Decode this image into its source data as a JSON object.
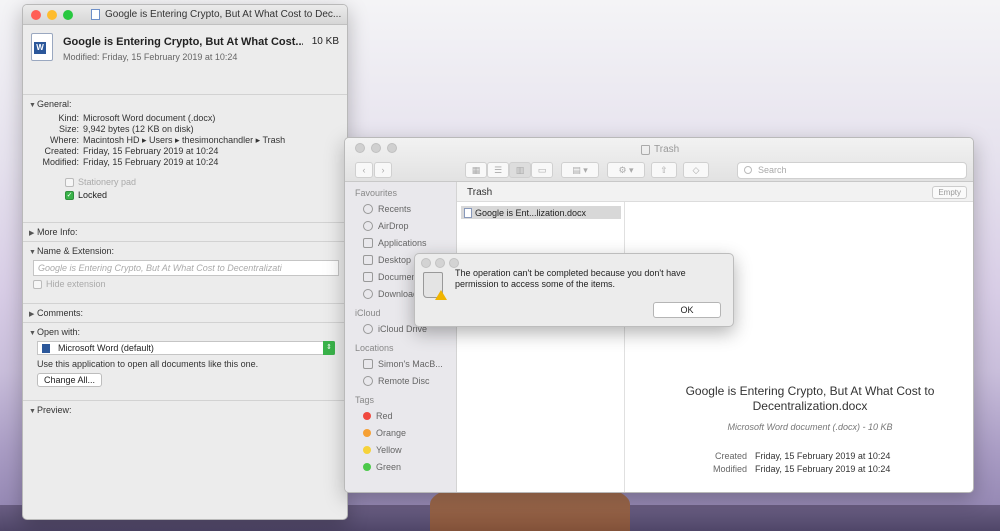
{
  "info_window": {
    "title": "Google is Entering Crypto, But At What Cost to Dec...",
    "file_name": "Google is Entering Crypto, But At What Cost...",
    "file_size": "10 KB",
    "modified_line": "Modified: Friday, 15 February 2019 at 10:24",
    "general": {
      "heading": "General:",
      "rows": [
        {
          "k": "Kind:",
          "v": "Microsoft Word document (.docx)"
        },
        {
          "k": "Size:",
          "v": "9,942 bytes (12 KB on disk)"
        },
        {
          "k": "Where:",
          "v": "Macintosh HD ▸ Users ▸ thesimonchandler ▸ Trash"
        },
        {
          "k": "Created:",
          "v": "Friday, 15 February 2019 at 10:24"
        },
        {
          "k": "Modified:",
          "v": "Friday, 15 February 2019 at 10:24"
        }
      ],
      "stationery_label": "Stationery pad",
      "locked_label": "Locked"
    },
    "more_info_heading": "More Info:",
    "name_ext": {
      "heading": "Name & Extension:",
      "field_value": "Google is Entering Crypto, But At What Cost to Decentralizati",
      "hide_ext_label": "Hide extension"
    },
    "comments_heading": "Comments:",
    "open_with": {
      "heading": "Open with:",
      "app": "Microsoft Word (default)",
      "hint": "Use this application to open all documents like this one.",
      "change_all": "Change All..."
    },
    "preview_heading": "Preview:"
  },
  "finder": {
    "title": "Trash",
    "search_placeholder": "Search",
    "sidebar": {
      "favourites_heading": "Favourites",
      "favourites": [
        "Recents",
        "AirDrop",
        "Applications",
        "Desktop",
        "Documents",
        "Downloads"
      ],
      "icloud_heading": "iCloud",
      "icloud": [
        "iCloud Drive"
      ],
      "locations_heading": "Locations",
      "locations": [
        "Simon's MacB...",
        "Remote Disc"
      ],
      "tags_heading": "Tags",
      "tags": [
        {
          "name": "Red",
          "color": "#f0483e"
        },
        {
          "name": "Orange",
          "color": "#f6a034"
        },
        {
          "name": "Yellow",
          "color": "#f6d23a"
        },
        {
          "name": "Green",
          "color": "#4cc94a"
        }
      ]
    },
    "column_label": "Trash",
    "empty_button": "Empty",
    "selected_file": "Google is Ent...lization.docx",
    "preview": {
      "name_line1": "Google is Entering Crypto, But At What Cost to",
      "name_line2": "Decentralization.docx",
      "type": "Microsoft Word document (.docx) - 10 KB",
      "created_k": "Created",
      "created_v": "Friday, 15 February 2019 at 10:24",
      "modified_k": "Modified",
      "modified_v": "Friday, 15 February 2019 at 10:24"
    }
  },
  "alert": {
    "message": "The operation can't be completed because you don't have permission to access some of the items.",
    "ok_label": "OK"
  },
  "colors": {
    "traffic_red": "#ff5f57",
    "traffic_yellow": "#febc2e",
    "traffic_green": "#28c840",
    "check_green": "#3ab34a"
  }
}
